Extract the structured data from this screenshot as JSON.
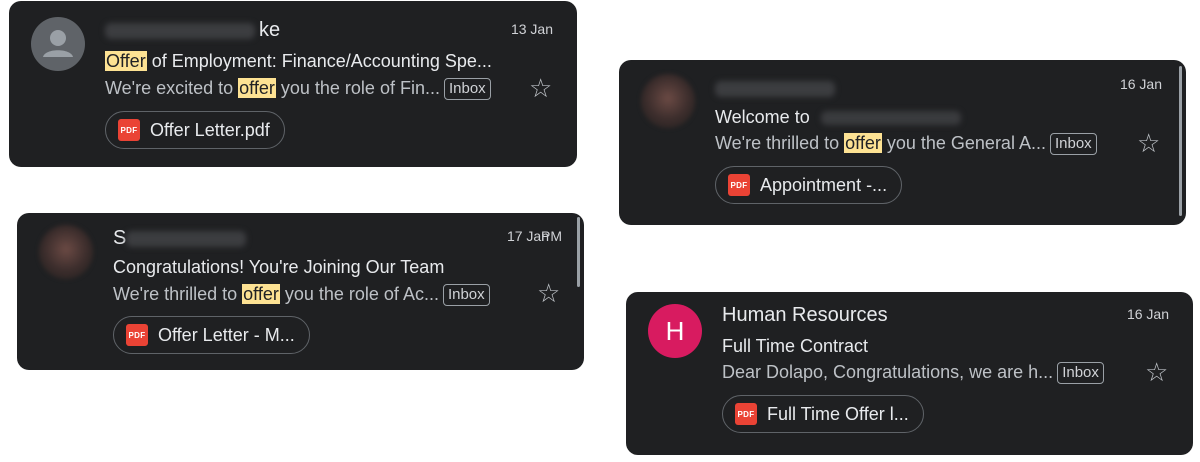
{
  "emails": [
    {
      "sender_visible": "ke",
      "date": "13 Jan",
      "subject": {
        "highlight": "Offer",
        "rest": " of Employment: Finance/Accounting Spe..."
      },
      "preview": {
        "before": "We're excited to ",
        "highlight": "offer",
        "after": " you the role of Fin..."
      },
      "label": "Inbox",
      "attachment": {
        "icon_text": "PDF",
        "name": "Offer Letter.pdf"
      },
      "avatar_icon": "person-icon"
    },
    {
      "sender_visible": "",
      "date": "16 Jan",
      "subject": {
        "text": "Welcome to"
      },
      "preview": {
        "before": "We're thrilled to ",
        "highlight": "offer",
        "after": " you the General A..."
      },
      "label": "Inbox",
      "attachment": {
        "icon_text": "PDF",
        "name": "Appointment -..."
      }
    },
    {
      "sender_visible": "S",
      "date": "17 Jan",
      "time_overlap": "PM",
      "subject": {
        "text": "Congratulations! You're Joining Our Team"
      },
      "preview": {
        "before": "We're thrilled to ",
        "highlight": "offer",
        "after": " you the role of Ac..."
      },
      "label": "Inbox",
      "attachment": {
        "icon_text": "PDF",
        "name": "Offer Letter - M..."
      }
    },
    {
      "sender": "Human Resources",
      "avatar_letter": "H",
      "date": "16 Jan",
      "subject": {
        "text": "Full Time Contract"
      },
      "preview": {
        "text": "Dear Dolapo, Congratulations, we are h..."
      },
      "label": "Inbox",
      "attachment": {
        "icon_text": "PDF",
        "name": "Full Time Offer l..."
      }
    }
  ],
  "colors": {
    "card_bg": "#1f2022",
    "highlight": "#fde293",
    "pdf_red": "#ea4335",
    "avatar_h": "#d81b60"
  }
}
